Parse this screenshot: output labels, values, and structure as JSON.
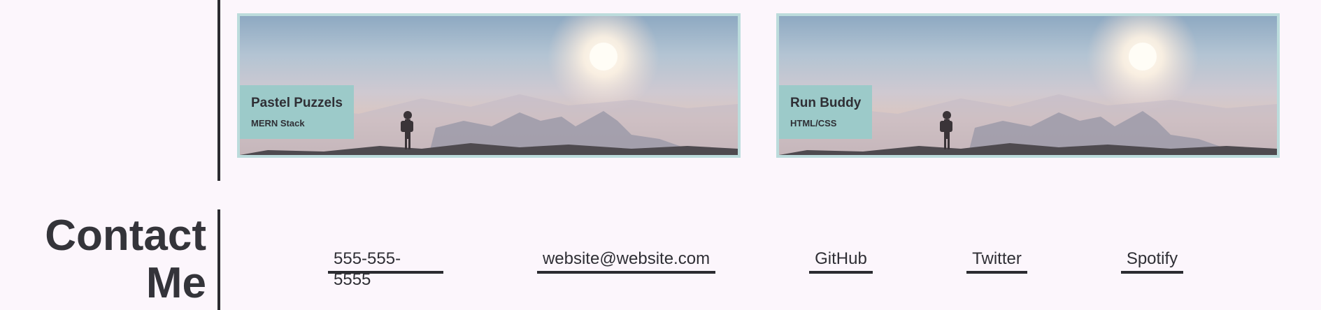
{
  "projects": [
    {
      "title": "Pastel Puzzels",
      "tech": "MERN Stack"
    },
    {
      "title": "Run Buddy",
      "tech": "HTML/CSS"
    }
  ],
  "contact": {
    "heading_line1": "Contact",
    "heading_line2": "Me",
    "links": [
      {
        "label": "555-555-5555"
      },
      {
        "label": "website@website.com"
      },
      {
        "label": "GitHub"
      },
      {
        "label": "Twitter"
      },
      {
        "label": "Spotify"
      }
    ]
  },
  "colors": {
    "background": "#fcf6fc",
    "accent": "#9ccac9",
    "card_border": "#bcdcdc",
    "text": "#2f2f35"
  }
}
